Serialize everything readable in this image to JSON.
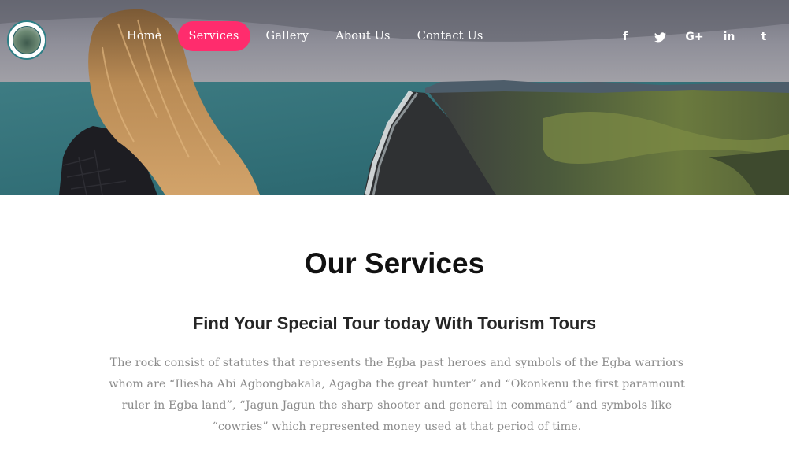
{
  "nav": {
    "items": [
      {
        "label": "Home",
        "active": false
      },
      {
        "label": "Services",
        "active": true
      },
      {
        "label": "Gallery",
        "active": false
      },
      {
        "label": "About Us",
        "active": false
      },
      {
        "label": "Contact Us",
        "active": false
      }
    ],
    "active_color": "#ff2c6d"
  },
  "social": {
    "items": [
      {
        "icon": "facebook-icon",
        "glyph": "f"
      },
      {
        "icon": "twitter-icon",
        "glyph": ""
      },
      {
        "icon": "google-plus-icon",
        "glyph": "G+"
      },
      {
        "icon": "linkedin-icon",
        "glyph": "in"
      },
      {
        "icon": "tumblr-icon",
        "glyph": "t"
      }
    ]
  },
  "content": {
    "title": "Our Services",
    "subtitle": "Find Your Special Tour today With Tourism Tours",
    "description": "The rock consist of statutes that represents the Egba past heroes and symbols of the Egba warriors whom are “Iliesha Abi Agbongbakala, Agagba the great hunter” and “Okonkenu the first paramount ruler in Egba land”, “Jagun Jagun the sharp shooter and general in command” and symbols like “cowries” which represented money used at that period of time."
  }
}
